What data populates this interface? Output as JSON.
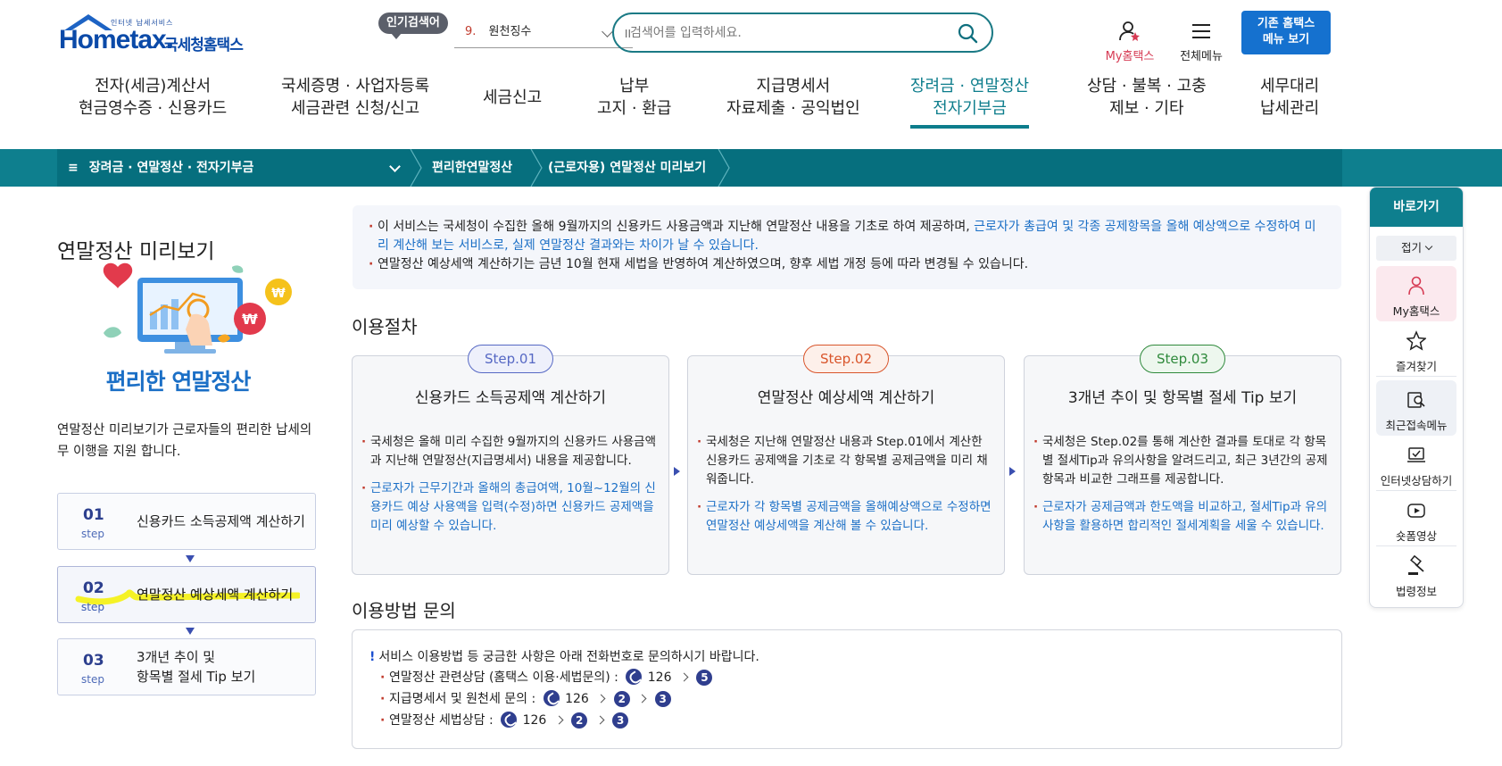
{
  "header": {
    "logo_small": "인터넷 납세서비스",
    "logo_word": "Hometax.",
    "logo_kr": "국세청홈택스",
    "popular_badge": "인기검색어",
    "popular_rank": "9.",
    "popular_term": "원천징수",
    "popular_pause": "II",
    "search_placeholder": "검색어를 입력하세요.",
    "my_hometax": "My홈택스",
    "all_menu": "전체메뉴",
    "old_menu_line1": "기존 홈택스",
    "old_menu_line2": "메뉴 보기"
  },
  "gnb": [
    {
      "line1": "전자(세금)계산서",
      "line2": "현금영수증 · 신용카드"
    },
    {
      "line1": "국세증명 · 사업자등록",
      "line2": "세금관련 신청/신고"
    },
    {
      "line1": "세금신고",
      "line2": ""
    },
    {
      "line1": "납부",
      "line2": "고지 · 환급"
    },
    {
      "line1": "지급명세서",
      "line2": "자료제출 · 공익법인"
    },
    {
      "line1": "장려금 · 연말정산",
      "line2": "전자기부금"
    },
    {
      "line1": "상담 · 불복 · 고충",
      "line2": "제보 · 기타"
    },
    {
      "line1": "세무대리",
      "line2": "납세관리"
    }
  ],
  "breadcrumb": {
    "menu_icon": "≡",
    "level1": "장려금 · 연말정산 · 전자기부금",
    "level2": "편리한연말정산",
    "level3": "(근로자용) 연말정산 미리보기"
  },
  "left": {
    "title": "연말정산 미리보기",
    "illus_title": "편리한 연말정산",
    "desc": "연말정산 미리보기가 근로자들의  편리한 납세의무 이행을 지원 합니다.",
    "steps": [
      {
        "num": "01",
        "label": "step",
        "text1": "신용카드 소득공제액 계산하기",
        "text2": ""
      },
      {
        "num": "02",
        "label": "step",
        "text1": "연말정산 예상세액 계산하기",
        "text2": ""
      },
      {
        "num": "03",
        "label": "step",
        "text1": "3개년 추이 및",
        "text2": "항목별 절세 Tip 보기"
      }
    ]
  },
  "notice": {
    "line1_a": "이 서비스는 국세청이 수집한 올해 9월까지의 신용카드 사용금액과 지난해 연말정산 내용을 기초로 하여 제공하며, ",
    "line1_b": "근로자가 총급여 및 각종 공제항목을 올해 예상액으로 수정하여 미리 계산해 보는 서비스로, 실제 연말정산 결과와는 차이가 날 수 있습니다.",
    "line2": "연말정산 예상세액 계산하기는 금년 10월 현재 세법을 반영하여 계산하였으며, 향후 세법 개정 등에 따라 변경될 수 있습니다."
  },
  "procedure": {
    "title": "이용절차",
    "cards": [
      {
        "pill": "Step.01",
        "pill_color": "#5668c4",
        "title": "신용카드 소득공제액 계산하기",
        "p1": "국세청은 올해 미리 수집한 9월까지의 신용카드 사용금액과 지난해 연말정산(지급명세서) 내용을 제공합니다.",
        "p2": "근로자가 근무기간과 올해의 총급여액, 10월~12월의 신용카드 예상 사용액을 입력(수정)하면 신용카드 공제액을 미리 예상할 수 있습니다."
      },
      {
        "pill": "Step.02",
        "pill_color": "#d9552b",
        "title": "연말정산 예상세액 계산하기",
        "p1": "국세청은 지난해 연말정산 내용과 Step.01에서 계산한 신용카드 공제액을 기초로 각 항목별 공제금액을 미리 채워줍니다.",
        "p2": "근로자가 각 항목별 공제금액을 올해예상액으로 수정하면 연말정산 예상세액을 계산해 볼 수 있습니다."
      },
      {
        "pill": "Step.03",
        "pill_color": "#2f8a3c",
        "title": "3개년 추이 및 항목별 절세 Tip 보기",
        "p1": "국세청은 Step.02를 통해 계산한 결과를 토대로 각 항목별 절세Tip과 유의사항을 알려드리고, 최근 3년간의 공제항목과 비교한 그래프를 제공합니다.",
        "p2": "근로자가 공제금액과 한도액을 비교하고, 절세Tip과 유의사항을 활용하면 합리적인 절세계획을 세울 수 있습니다."
      }
    ]
  },
  "contact": {
    "title": "이용방법 문의",
    "mark": "!",
    "head": "서비스 이용방법 등 궁금한 사항은 아래 전화번호로 문의하시기 바랍니다.",
    "rows": [
      {
        "label": "연말정산 관련상담 (홈택스 이용·세법문의) :",
        "number": "126",
        "keys": [
          "5"
        ]
      },
      {
        "label": "지급명세서 및 원천세 문의 :",
        "number": "126",
        "keys": [
          "2",
          "3"
        ]
      },
      {
        "label": "연말정산 세법상담 :",
        "number": "126",
        "keys": [
          "2",
          "3"
        ]
      }
    ]
  },
  "quick": {
    "title": "바로가기",
    "fold": "접기",
    "items": [
      "My홈택스",
      "즐겨찾기",
      "최근접속메뉴",
      "인터넷상담하기",
      "숏폼영상",
      "법령정보"
    ]
  }
}
